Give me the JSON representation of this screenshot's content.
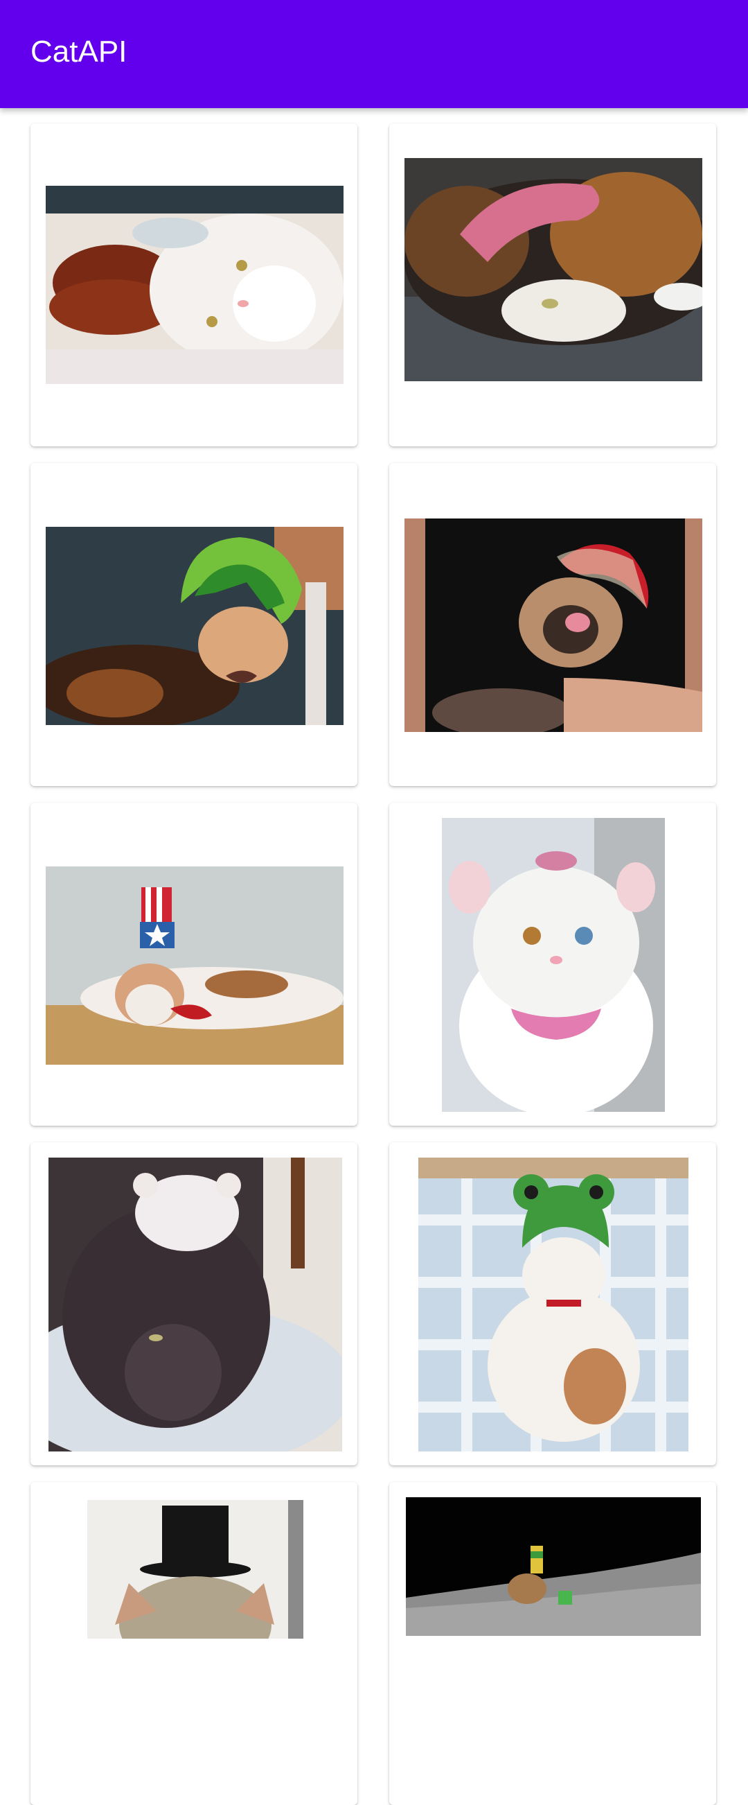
{
  "app_bar": {
    "title": "CatAPI",
    "color": "#6200ee"
  },
  "grid": {
    "cards": [
      {
        "image": "cat-with-red-donut-toy"
      },
      {
        "image": "calico-cat-pink-crochet-hat"
      },
      {
        "image": "calico-cat-green-dinosaur-hat"
      },
      {
        "image": "siamese-cat-red-hat"
      },
      {
        "image": "calico-cat-uncle-sam-hat"
      },
      {
        "image": "white-cat-bunny-hood"
      },
      {
        "image": "dark-cat-knitted-hat"
      },
      {
        "image": "tabby-cat-frog-hat"
      },
      {
        "image": "cat-top-hat"
      },
      {
        "image": "cat-on-moon"
      }
    ]
  }
}
